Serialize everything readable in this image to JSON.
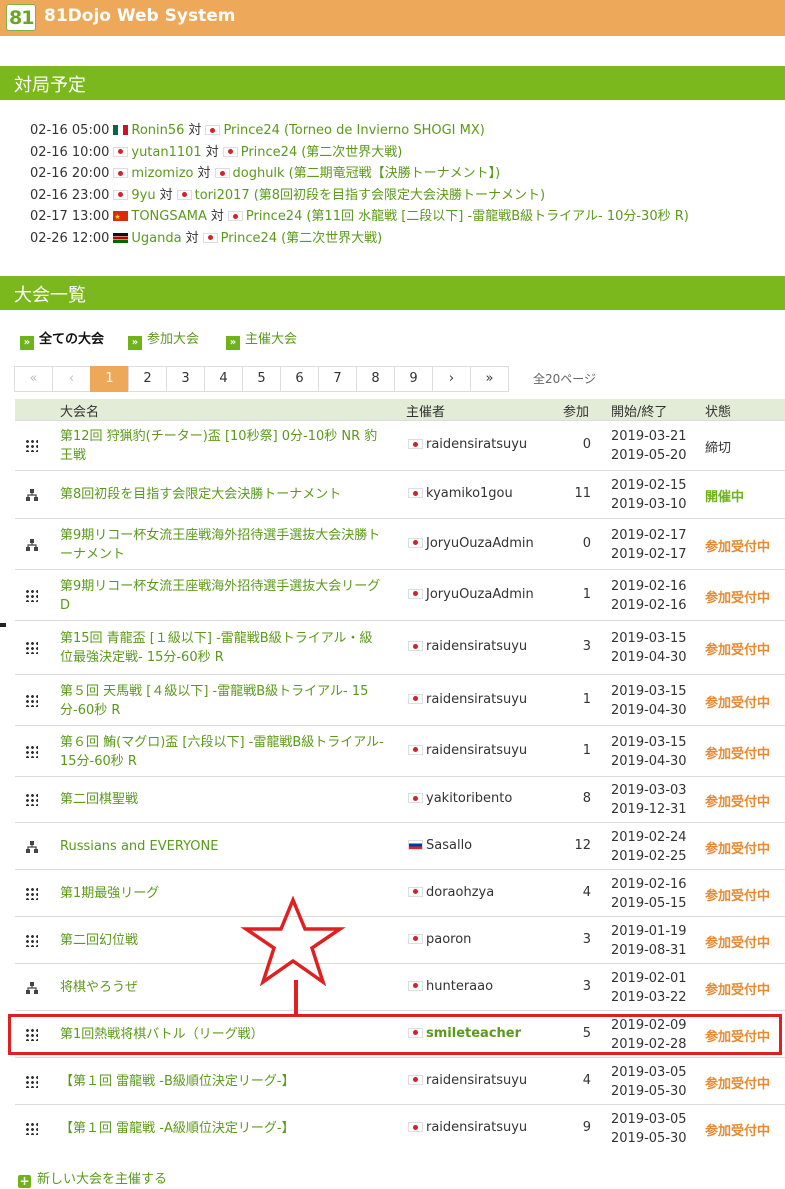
{
  "app": {
    "logo_text": "81",
    "title": "81Dojo Web System"
  },
  "schedule": {
    "heading": "対局予定",
    "vs": "対",
    "matches": [
      {
        "time": "02-16 05:00",
        "p1": "Ronin56",
        "p1_flag": "mx",
        "p2": "Prince24",
        "p2_flag": "jp",
        "event": "(Torneo de Invierno SHOGI MX)"
      },
      {
        "time": "02-16 10:00",
        "p1": "yutan1101",
        "p1_flag": "jp",
        "p2": "Prince24",
        "p2_flag": "jp",
        "event": "(第二次世界大戦)"
      },
      {
        "time": "02-16 20:00",
        "p1": "mizomizo",
        "p1_flag": "jp",
        "p2": "doghulk",
        "p2_flag": "jp",
        "event": "(第二期竜冠戦【決勝トーナメント】)"
      },
      {
        "time": "02-16 23:00",
        "p1": "9yu",
        "p1_flag": "jp",
        "p2": "tori2017",
        "p2_flag": "jp",
        "event": "(第8回初段を目指す会限定大会決勝トーナメント)"
      },
      {
        "time": "02-17 13:00",
        "p1": "TONGSAMA",
        "p1_flag": "cn",
        "p2": "Prince24",
        "p2_flag": "jp",
        "event": "(第11回 水龍戦 [二段以下] -雷龍戦B級トライアル- 10分-30秒 R)"
      },
      {
        "time": "02-26 12:00",
        "p1": "Uganda",
        "p1_flag": "ke",
        "p2": "Prince24",
        "p2_flag": "jp",
        "event": "(第二次世界大戦)"
      }
    ]
  },
  "tournaments": {
    "heading": "大会一覧",
    "tabs": [
      {
        "label": "全ての大会",
        "active": true
      },
      {
        "label": "参加大会",
        "active": false
      },
      {
        "label": "主催大会",
        "active": false
      }
    ],
    "pager": {
      "first": "«",
      "prev": "‹",
      "pages": [
        "1",
        "2",
        "3",
        "4",
        "5",
        "6",
        "7",
        "8",
        "9"
      ],
      "current": "1",
      "next": "›",
      "last": "»",
      "total": "全20ページ"
    },
    "columns": {
      "name": "大会名",
      "host": "主催者",
      "participants": "参加",
      "period": "開始/終了",
      "status": "状態"
    },
    "rows": [
      {
        "icon": "grid",
        "name": "第12回 狩猟豹(チーター)盃 [10秒祭] 0分-10秒 NR 豹王戦",
        "host": "raidensiratsuyu",
        "flag": "jp",
        "count": "0",
        "start": "2019-03-21",
        "end": "2019-05-20",
        "status": "締切",
        "status_type": "closed"
      },
      {
        "icon": "tree",
        "name": "第8回初段を目指す会限定大会決勝トーナメント",
        "host": "kyamiko1gou",
        "flag": "jp",
        "count": "11",
        "start": "2019-02-15",
        "end": "2019-03-10",
        "status": "開催中",
        "status_type": "live"
      },
      {
        "icon": "tree",
        "name": "第9期リコー杯女流王座戦海外招待選手選抜大会決勝トーナメント",
        "host": "JoryuOuzaAdmin",
        "flag": "jp",
        "count": "0",
        "start": "2019-02-17",
        "end": "2019-02-17",
        "status": "参加受付中",
        "status_type": "open"
      },
      {
        "icon": "grid",
        "name": "第9期リコー杯女流王座戦海外招待選手選抜大会リーグD",
        "host": "JoryuOuzaAdmin",
        "flag": "jp",
        "count": "1",
        "start": "2019-02-16",
        "end": "2019-02-16",
        "status": "参加受付中",
        "status_type": "open"
      },
      {
        "icon": "grid",
        "name": "第15回 青龍盃 [１級以下] -雷龍戦B級トライアル・級位最強決定戦- 15分-60秒 R",
        "host": "raidensiratsuyu",
        "flag": "jp",
        "count": "3",
        "start": "2019-03-15",
        "end": "2019-04-30",
        "status": "参加受付中",
        "status_type": "open"
      },
      {
        "icon": "grid",
        "name": "第５回 天馬戦 [４級以下] -雷龍戦B級トライアル- 15分-60秒 R",
        "host": "raidensiratsuyu",
        "flag": "jp",
        "count": "1",
        "start": "2019-03-15",
        "end": "2019-04-30",
        "status": "参加受付中",
        "status_type": "open"
      },
      {
        "icon": "grid",
        "name": "第６回 鮪(マグロ)盃 [六段以下] -雷龍戦B級トライアル- 15分-60秒 R",
        "host": "raidensiratsuyu",
        "flag": "jp",
        "count": "1",
        "start": "2019-03-15",
        "end": "2019-04-30",
        "status": "参加受付中",
        "status_type": "open"
      },
      {
        "icon": "grid",
        "name": "第二回棋聖戦",
        "host": "yakitoribento",
        "flag": "jp",
        "count": "8",
        "start": "2019-03-03",
        "end": "2019-12-31",
        "status": "参加受付中",
        "status_type": "open"
      },
      {
        "icon": "tree",
        "name": "Russians and EVERYONE",
        "host": "Sasallo",
        "flag": "ru",
        "count": "12",
        "start": "2019-02-24",
        "end": "2019-02-25",
        "status": "参加受付中",
        "status_type": "open"
      },
      {
        "icon": "grid",
        "name": "第1期最強リーグ",
        "host": "doraohzya",
        "flag": "jp",
        "count": "4",
        "start": "2019-02-16",
        "end": "2019-05-15",
        "status": "参加受付中",
        "status_type": "open"
      },
      {
        "icon": "grid",
        "name": "第二回幻位戦",
        "host": "paoron",
        "flag": "jp",
        "count": "3",
        "start": "2019-01-19",
        "end": "2019-08-31",
        "status": "参加受付中",
        "status_type": "open"
      },
      {
        "icon": "tree",
        "name": "将棋やろうぜ",
        "host": "hunteraao",
        "flag": "jp",
        "count": "3",
        "start": "2019-02-01",
        "end": "2019-03-22",
        "status": "参加受付中",
        "status_type": "open"
      },
      {
        "icon": "grid",
        "name": "第1回熱戦将棋バトル（リーグ戦）",
        "host": "smileteacher",
        "flag": "jp",
        "count": "5",
        "start": "2019-02-09",
        "end": "2019-02-28",
        "status": "参加受付中",
        "status_type": "open",
        "host_bold": true
      },
      {
        "icon": "grid",
        "name": "【第１回 雷龍戦 -B級順位決定リーグ-】",
        "host": "raidensiratsuyu",
        "flag": "jp",
        "count": "4",
        "start": "2019-03-05",
        "end": "2019-05-30",
        "status": "参加受付中",
        "status_type": "open"
      },
      {
        "icon": "grid",
        "name": "【第１回 雷龍戦 -A級順位決定リーグ-】",
        "host": "raidensiratsuyu",
        "flag": "jp",
        "count": "9",
        "start": "2019-03-05",
        "end": "2019-05-30",
        "status": "参加受付中",
        "status_type": "open"
      }
    ],
    "new_link": "新しい大会を主催する"
  },
  "colors": {
    "header": "#eea85a",
    "section": "#7bb81d",
    "link": "#5a9a1a",
    "open": "#e98a32",
    "annotation": "#e02020"
  }
}
